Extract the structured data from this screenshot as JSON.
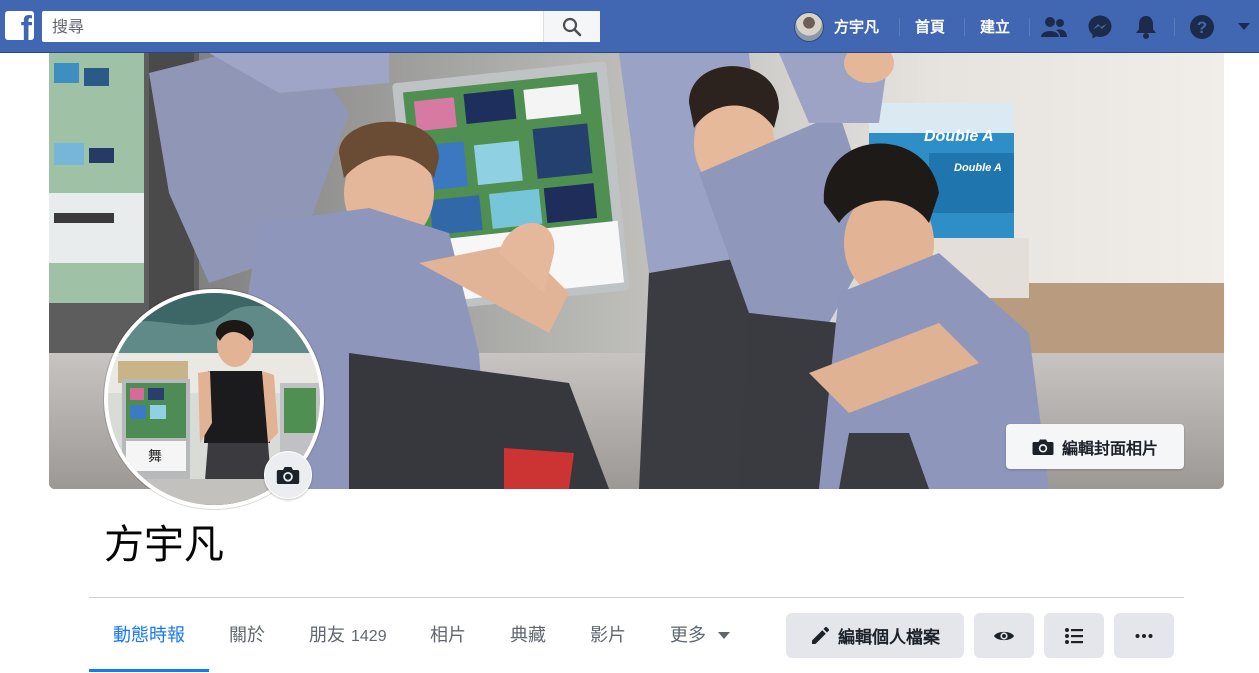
{
  "topbar": {
    "search_placeholder": "搜尋",
    "user_name": "方宇凡",
    "home_label": "首頁",
    "create_label": "建立"
  },
  "cover": {
    "edit_cover_label": "編輯封面相片"
  },
  "profile": {
    "name": "方宇凡"
  },
  "tabs": [
    {
      "label": "動態時報",
      "active": true
    },
    {
      "label": "關於"
    },
    {
      "label": "朋友",
      "count": "1429"
    },
    {
      "label": "相片"
    },
    {
      "label": "典藏"
    },
    {
      "label": "影片"
    },
    {
      "label": "更多"
    }
  ],
  "actions": {
    "edit_profile_label": "編輯個人檔案"
  },
  "colors": {
    "topbar": "#4267b2",
    "active_tab": "#1877f2",
    "button_bg": "#e4e6eb"
  }
}
